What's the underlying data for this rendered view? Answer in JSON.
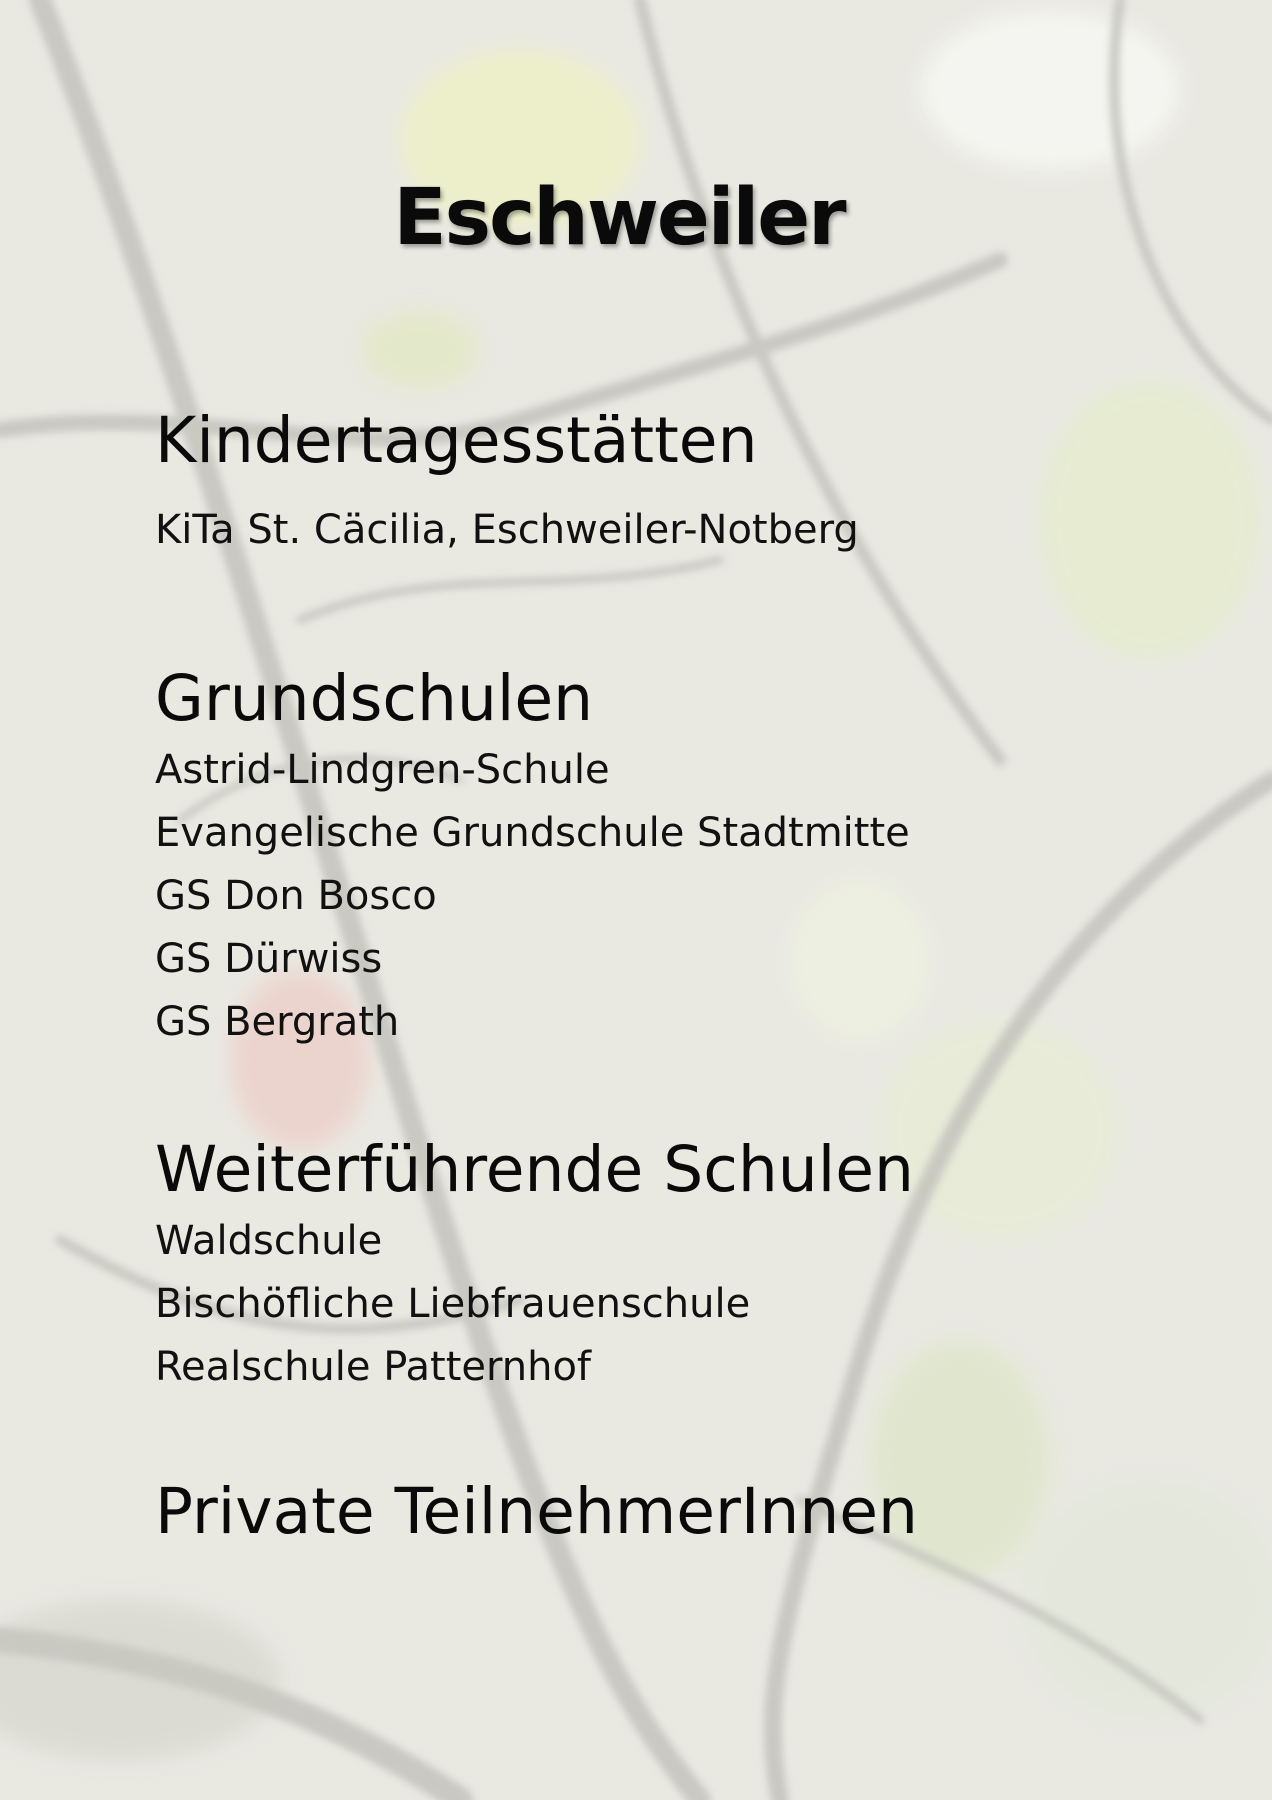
{
  "title": "Eschweiler",
  "sections": [
    {
      "heading": "Kindertagesstätten",
      "items": [
        "KiTa St. Cäcilia, Eschweiler-Notberg"
      ]
    },
    {
      "heading": "Grundschulen",
      "items": [
        "Astrid-Lindgren-Schule",
        "Evangelische Grundschule Stadtmitte",
        "GS Don Bosco",
        "GS Dürwiss",
        "GS Bergrath"
      ]
    },
    {
      "heading": "Weiterführende Schulen",
      "items": [
        "Waldschule",
        "Bischöfliche Liebfrauenschule",
        "Realschule Patternhof"
      ]
    },
    {
      "heading": "Private TeilnehmerInnen",
      "items": []
    }
  ]
}
